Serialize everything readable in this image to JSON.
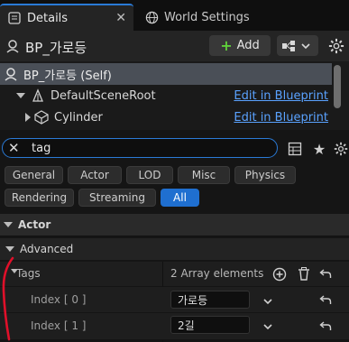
{
  "tabs": [
    {
      "label": "Details",
      "icon": "details-icon"
    },
    {
      "label": "World Settings",
      "icon": "globe-icon"
    }
  ],
  "header": {
    "title": "BP_가로등",
    "add_label": "Add"
  },
  "tree": [
    {
      "label": "BP_가로등 (Self)",
      "link": ""
    },
    {
      "label": "DefaultSceneRoot",
      "link": "Edit in Blueprint"
    },
    {
      "label": "Cylinder",
      "link": "Edit in Blueprint"
    }
  ],
  "search": {
    "value": "tag"
  },
  "filters": [
    {
      "label": "General"
    },
    {
      "label": "Actor"
    },
    {
      "label": "LOD"
    },
    {
      "label": "Misc"
    },
    {
      "label": "Physics"
    },
    {
      "label": "Rendering"
    },
    {
      "label": "Streaming"
    },
    {
      "label": "All"
    }
  ],
  "sections": {
    "actor": "Actor",
    "advanced": "Advanced"
  },
  "tags": {
    "label": "Tags",
    "count": "2 Array elements",
    "items": [
      {
        "index": "Index [ 0 ]",
        "value": "가로등"
      },
      {
        "index": "Index [ 1 ]",
        "value": "2길"
      }
    ]
  },
  "colors": {
    "accent": "#1f6fd0",
    "link": "#5aa2ff",
    "annotation": "#e0102a"
  }
}
